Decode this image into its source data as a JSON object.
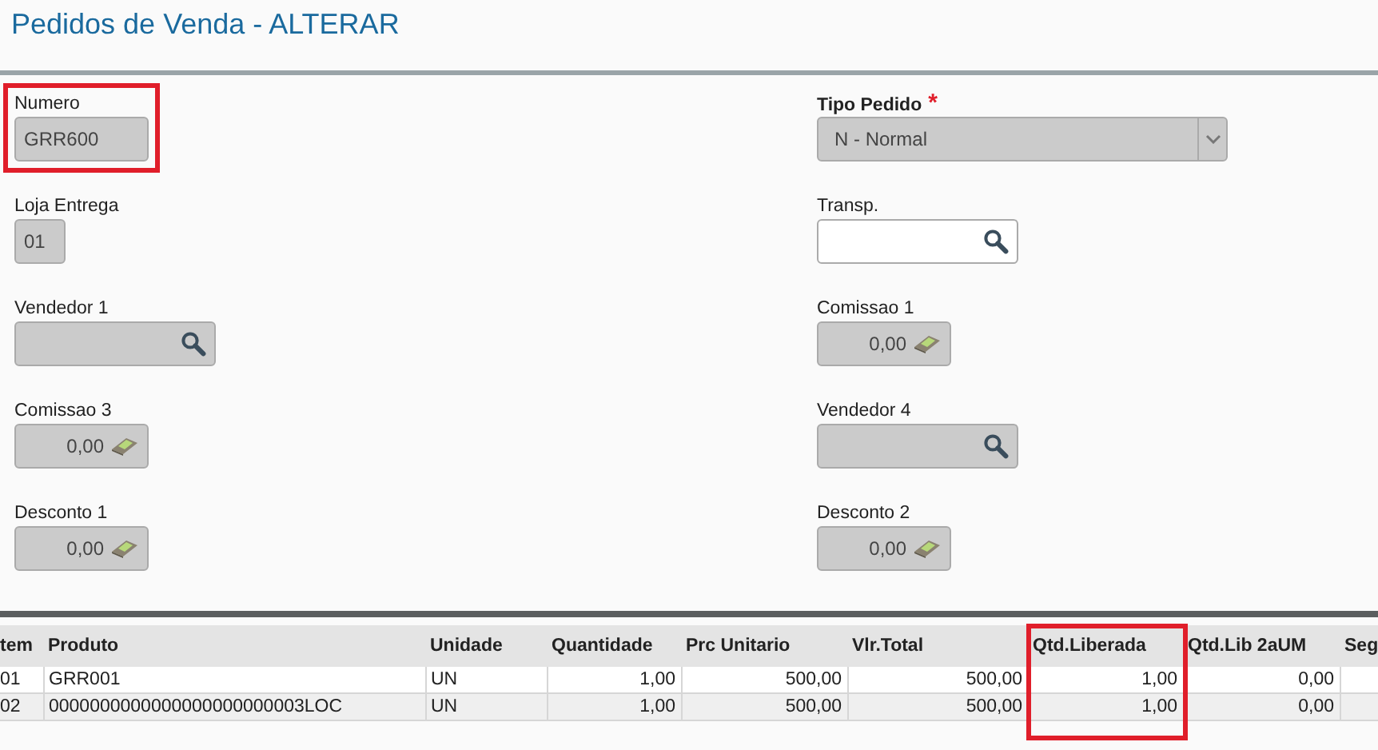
{
  "title": "Pedidos de Venda - ALTERAR",
  "fields": [
    {
      "label": "Numero",
      "kind": "text",
      "value": "GRR600",
      "disabled": true,
      "highlighted": true
    },
    {
      "label": "Tipo Pedido",
      "kind": "select",
      "value": "N - Normal",
      "disabled": true,
      "required_mark": "*",
      "highlighted": false
    },
    {
      "label": "Loja Entrega",
      "kind": "text",
      "value": "01",
      "disabled": true,
      "highlighted": false
    },
    {
      "label": "Transp.",
      "kind": "lookup",
      "disabled": false,
      "highlighted": false
    },
    {
      "label": "Vendedor 1",
      "kind": "lookup",
      "disabled": true,
      "highlighted": false
    },
    {
      "label": "Comissao 1",
      "kind": "currency",
      "value": "0,00",
      "disabled": true,
      "highlighted": false
    },
    {
      "label": "Comissao 3",
      "kind": "currency",
      "value": "0,00",
      "disabled": true,
      "highlighted": false
    },
    {
      "label": "Vendedor 4",
      "kind": "lookup",
      "disabled": true,
      "highlighted": false
    },
    {
      "label": "Desconto 1",
      "kind": "currency",
      "value": "0,00",
      "disabled": true,
      "highlighted": false
    },
    {
      "label": "Desconto 2",
      "kind": "currency",
      "value": "0,00",
      "disabled": true,
      "highlighted": false
    }
  ],
  "table": {
    "columns": [
      {
        "label": "tem",
        "highlighted": false
      },
      {
        "label": "Produto",
        "highlighted": false
      },
      {
        "label": "Unidade",
        "highlighted": false
      },
      {
        "label": "Quantidade",
        "highlighted": false
      },
      {
        "label": "Prc Unitario",
        "highlighted": false
      },
      {
        "label": "Vlr.Total",
        "highlighted": false
      },
      {
        "label": "Qtd.Liberada",
        "highlighted": true
      },
      {
        "label": "Qtd.Lib 2aUM",
        "highlighted": false
      },
      {
        "label": "Seg",
        "highlighted": false
      }
    ],
    "rows": [
      [
        "01",
        "GRR001",
        "UN",
        "1,00",
        "500,00",
        "500,00",
        "1,00",
        "0,00",
        null
      ],
      [
        "02",
        "0000000000000000000000003LOC",
        "UN",
        "1,00",
        "500,00",
        "500,00",
        "1,00",
        "0,00",
        null
      ]
    ]
  }
}
